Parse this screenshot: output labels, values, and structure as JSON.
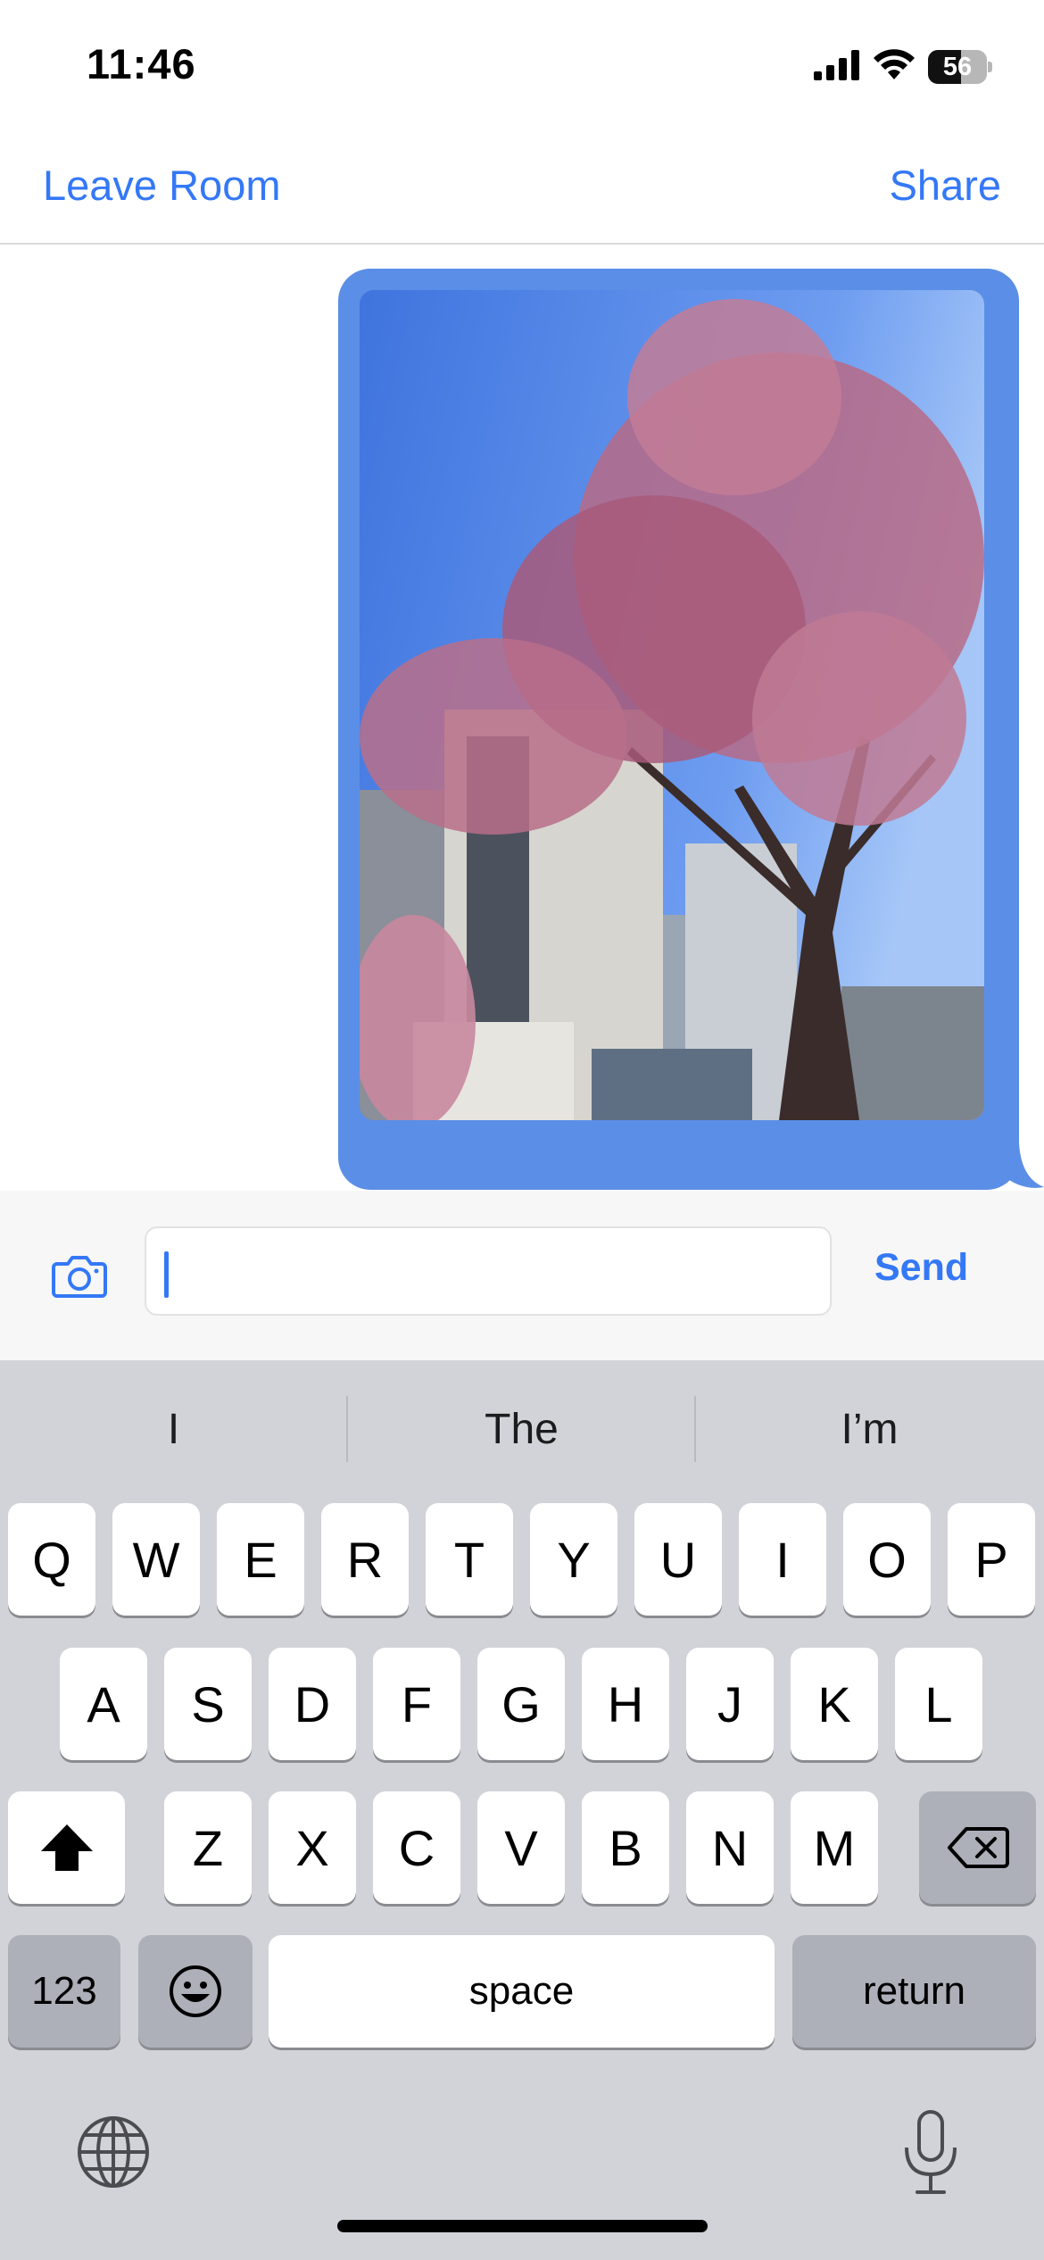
{
  "status_bar": {
    "time": "11:46",
    "battery_percent": "56",
    "battery_level": 0.56
  },
  "nav": {
    "left_label": "Leave Room",
    "right_label": "Share"
  },
  "composer": {
    "input_value": "",
    "send_label": "Send"
  },
  "keyboard": {
    "suggestions": [
      "I",
      "The",
      "I’m"
    ],
    "row1": [
      "Q",
      "W",
      "E",
      "R",
      "T",
      "Y",
      "U",
      "I",
      "O",
      "P"
    ],
    "row2": [
      "A",
      "S",
      "D",
      "F",
      "G",
      "H",
      "J",
      "K",
      "L"
    ],
    "row3": [
      "Z",
      "X",
      "C",
      "V",
      "B",
      "N",
      "M"
    ],
    "numbers_label": "123",
    "space_label": "space",
    "return_label": "return"
  },
  "colors": {
    "accent": "#3478f6",
    "bubble": "#5b8ee6",
    "keyboard_bg": "#d1d3d9"
  },
  "icons": {
    "signal": "cellular-signal-icon",
    "wifi": "wifi-icon",
    "battery": "battery-icon",
    "camera": "camera-icon",
    "shift": "shift-icon",
    "delete": "delete-icon",
    "emoji": "emoji-icon",
    "globe": "globe-icon",
    "mic": "microphone-icon"
  }
}
